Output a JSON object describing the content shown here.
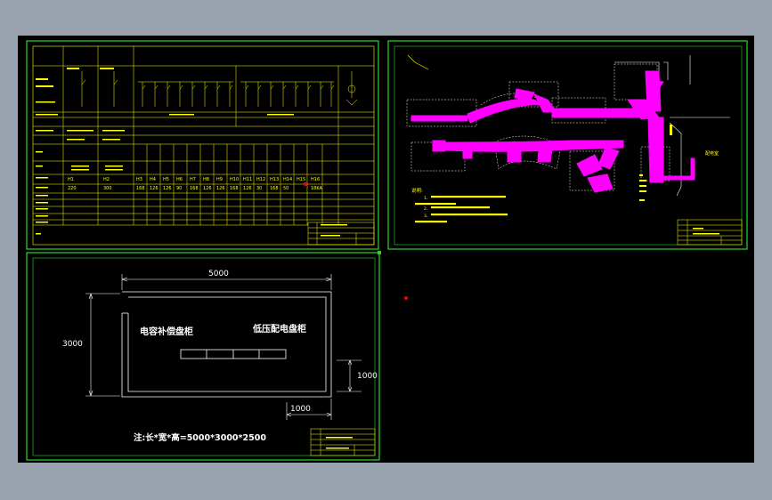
{
  "canvas": {
    "background_color": "#000000",
    "frame_color": "#2bd42b",
    "line_color": "#ffff00",
    "route_color": "#ff00ff",
    "dim_color": "#ffffff",
    "marker_color": "#ff0000"
  },
  "sheet1": {
    "table_rows": [
      {
        "label": "",
        "cells": [
          "H1",
          "",
          "H2",
          "",
          "H3",
          "H4",
          "H5",
          "H6",
          "H7",
          "H8",
          "H9",
          "H10",
          "H11",
          "H12",
          "H13",
          "H14",
          "H15",
          "H16"
        ]
      },
      {
        "label": "",
        "cells": [
          "220",
          "",
          "300",
          "",
          "168",
          "126",
          "126",
          "90",
          "168",
          "126",
          "126",
          "168",
          "126",
          "30",
          "168",
          "50",
          "",
          "18KA"
        ]
      }
    ],
    "title_block": {
      "drawing_name": "",
      "sheet_name": ""
    }
  },
  "sheet2": {
    "notes_heading": "说明:",
    "notes_lines": [
      "1、",
      "",
      "2、",
      "3、"
    ],
    "label_right": "配电室",
    "title_block": {
      "drawing_name": "",
      "sheet_name": ""
    }
  },
  "sheet3": {
    "dim_width": "5000",
    "dim_height": "3000",
    "dim_door_v": "1000",
    "dim_door_h": "1000",
    "label_capacitor": "电容补偿盘柜",
    "label_lv": "低压配电盘柜",
    "note": "注:长*宽*高=5000*3000*2500",
    "title_block": {
      "drawing_name": "",
      "sheet_name": ""
    }
  }
}
